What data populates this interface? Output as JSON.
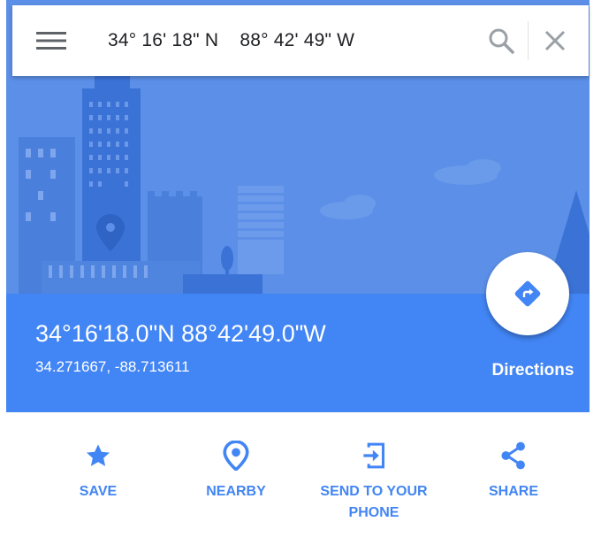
{
  "search": {
    "query": "34° 16' 18\" N    88° 42' 49\" W"
  },
  "place": {
    "coordinates_dms": "34°16'18.0\"N 88°42'49.0\"W",
    "coordinates_decimal": "34.271667, -88.713611"
  },
  "directions": {
    "label": "Directions"
  },
  "actions": [
    {
      "label": "SAVE",
      "icon": "star-icon"
    },
    {
      "label": "NEARBY",
      "icon": "nearby-pin-icon"
    },
    {
      "label": "SEND TO YOUR\nPHONE",
      "icon": "send-to-phone-icon"
    },
    {
      "label": "SHARE",
      "icon": "share-icon"
    }
  ],
  "colors": {
    "accent": "#4285f4",
    "hero_bg": "#5c8fe7"
  }
}
